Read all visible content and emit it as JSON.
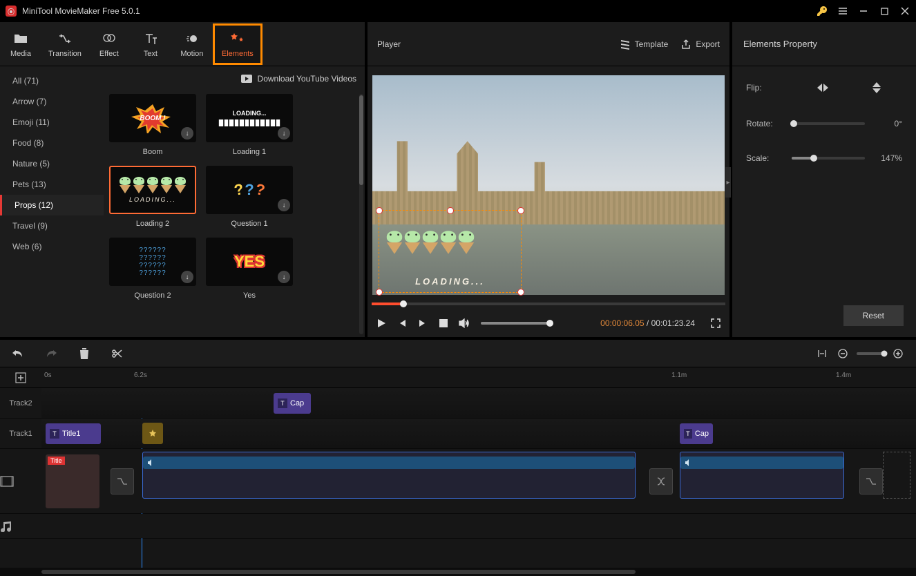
{
  "app": {
    "title": "MiniTool MovieMaker Free 5.0.1"
  },
  "topnav": {
    "items": [
      {
        "label": "Media"
      },
      {
        "label": "Transition"
      },
      {
        "label": "Effect"
      },
      {
        "label": "Text"
      },
      {
        "label": "Motion"
      },
      {
        "label": "Elements"
      }
    ]
  },
  "categories": {
    "items": [
      {
        "label": "All (71)"
      },
      {
        "label": "Arrow (7)"
      },
      {
        "label": "Emoji (11)"
      },
      {
        "label": "Food (8)"
      },
      {
        "label": "Nature (5)"
      },
      {
        "label": "Pets (13)"
      },
      {
        "label": "Props (12)"
      },
      {
        "label": "Travel (9)"
      },
      {
        "label": "Web (6)"
      }
    ],
    "download_yt": "Download YouTube Videos"
  },
  "tiles": {
    "items": [
      {
        "label": "Boom"
      },
      {
        "label": "Loading 1"
      },
      {
        "label": "Loading 2"
      },
      {
        "label": "Question 1"
      },
      {
        "label": "Question 2"
      },
      {
        "label": "Yes"
      }
    ],
    "loading_text_upper": "LOADING...",
    "loading_text_italic": "LOADING...",
    "boom_text": "BOOM !",
    "qmarks": "??????",
    "yes_text": "YES"
  },
  "player": {
    "title": "Player",
    "template": "Template",
    "export": "Export",
    "overlay_label": "LOADING...",
    "current_time": "00:00:06.05",
    "total_time": "00:01:23.24",
    "sep": " / "
  },
  "props": {
    "title": "Elements Property",
    "flip_label": "Flip:",
    "rotate_label": "Rotate:",
    "scale_label": "Scale:",
    "rotate_value": "0°",
    "scale_value": "147%",
    "reset": "Reset"
  },
  "timeline": {
    "ruler": {
      "t0": "0s",
      "t1": "6.2s",
      "t2": "1.1m",
      "t3": "1.4m"
    },
    "tracks": {
      "track2": "Track2",
      "track1": "Track1"
    },
    "clips": {
      "caption1": "Cap",
      "title1": "Title1",
      "caption2": "Cap",
      "title_tag": "Title"
    }
  }
}
